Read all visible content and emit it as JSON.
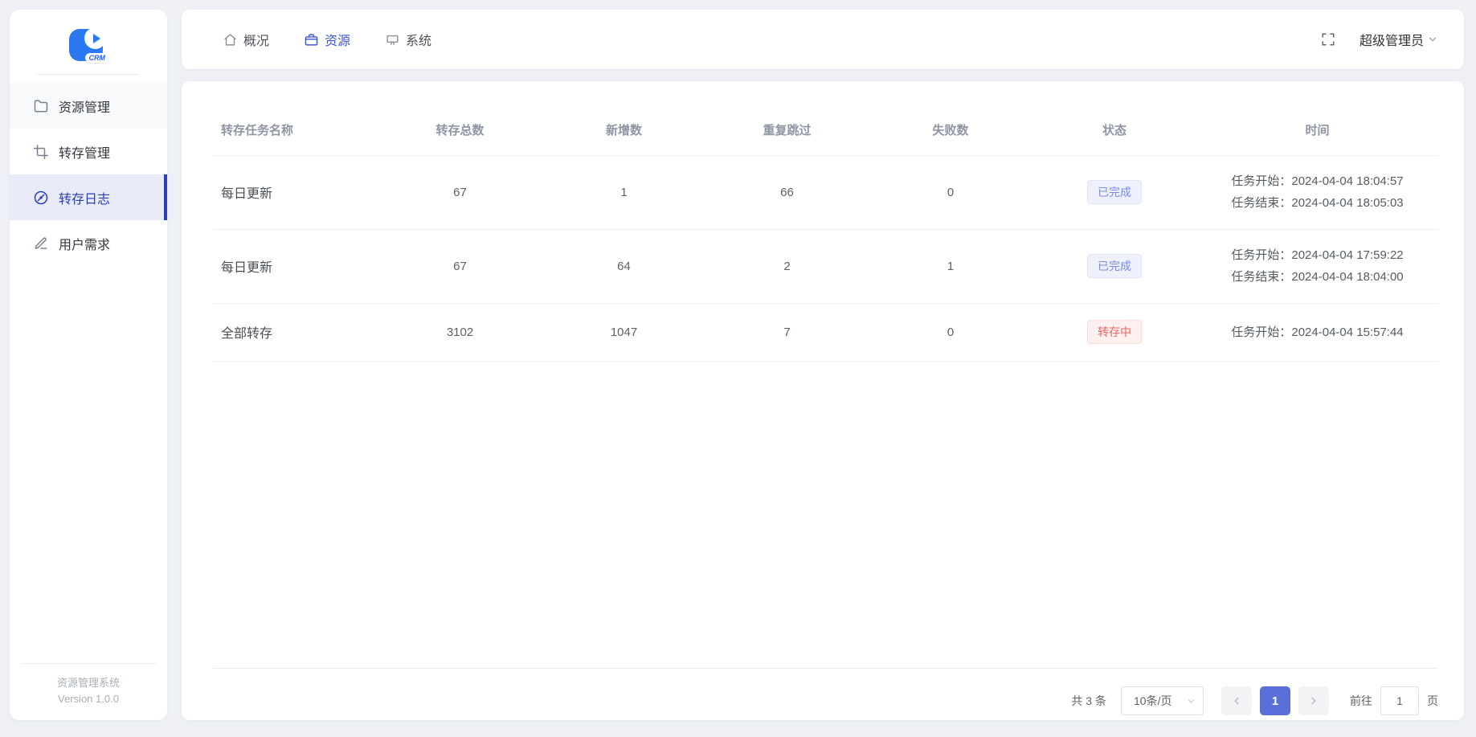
{
  "sidebar": {
    "logo_text": "CRM",
    "items": [
      {
        "label": "资源管理",
        "icon": "folder-icon"
      },
      {
        "label": "转存管理",
        "icon": "crop-icon"
      },
      {
        "label": "转存日志",
        "icon": "compass-icon",
        "active": true
      },
      {
        "label": "用户需求",
        "icon": "pencil-icon"
      }
    ],
    "footer_title": "资源管理系统",
    "footer_version": "Version 1.0.0"
  },
  "header": {
    "tabs": [
      {
        "label": "概况",
        "icon": "home-icon"
      },
      {
        "label": "资源",
        "icon": "briefcase-icon",
        "active": true
      },
      {
        "label": "系统",
        "icon": "monitor-icon"
      }
    ],
    "user_menu_label": "超级管理员"
  },
  "table": {
    "columns": [
      "转存任务名称",
      "转存总数",
      "新增数",
      "重复跳过",
      "失败数",
      "状态",
      "时间"
    ],
    "rows": [
      {
        "name": "每日更新",
        "total": "67",
        "added": "1",
        "skipped": "66",
        "failed": "0",
        "status": "已完成",
        "status_type": "info",
        "time_start_label": "任务开始：",
        "time_start": "2024-04-04 18:04:57",
        "time_end_label": "任务结束：",
        "time_end": "2024-04-04 18:05:03"
      },
      {
        "name": "每日更新",
        "total": "67",
        "added": "64",
        "skipped": "2",
        "failed": "1",
        "status": "已完成",
        "status_type": "info",
        "time_start_label": "任务开始：",
        "time_start": "2024-04-04 17:59:22",
        "time_end_label": "任务结束：",
        "time_end": "2024-04-04 18:04:00"
      },
      {
        "name": "全部转存",
        "total": "3102",
        "added": "1047",
        "skipped": "7",
        "failed": "0",
        "status": "转存中",
        "status_type": "danger",
        "time_start_label": "任务开始：",
        "time_start": "2024-04-04 15:57:44",
        "time_end_label": "",
        "time_end": ""
      }
    ]
  },
  "pagination": {
    "total_label": "共 3 条",
    "page_size_label": "10条/页",
    "current_page": "1",
    "goto_label": "前往",
    "goto_value": "1",
    "goto_suffix": "页"
  },
  "colors": {
    "page_background": "#eef0f6",
    "logo_blue": "#2a79f2",
    "sidebar_active": "#2c3eb8",
    "tab_active": "#3d55d0",
    "pagination_active": "#5a6fd8",
    "badge_info_text": "#7e8bdc",
    "badge_danger_text": "#ec6661"
  }
}
